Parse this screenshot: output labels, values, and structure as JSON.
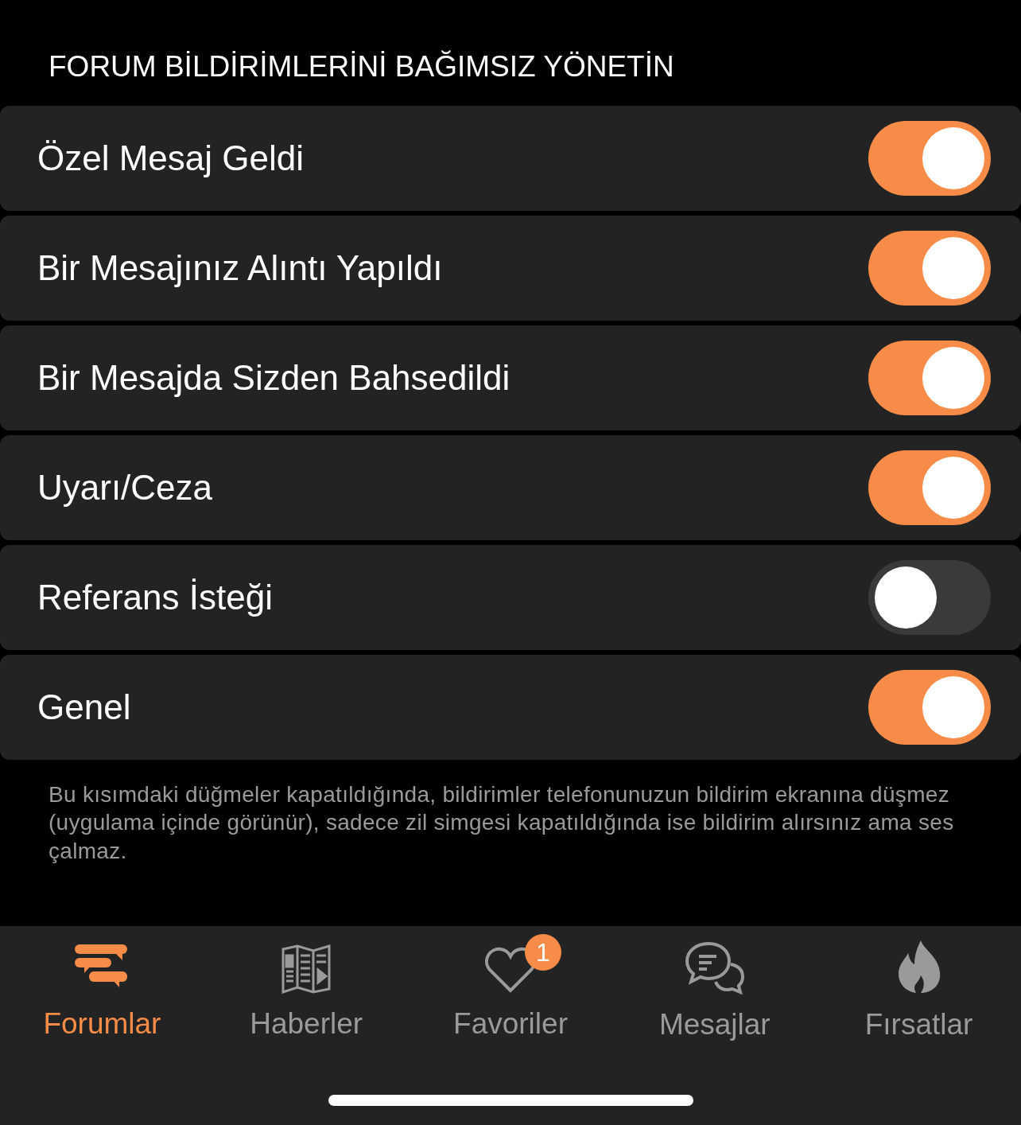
{
  "section_header": "FORUM BİLDİRİMLERİNİ BAĞIMSIZ YÖNETİN",
  "settings": [
    {
      "label": "Özel Mesaj Geldi",
      "on": true
    },
    {
      "label": "Bir Mesajınız Alıntı Yapıldı",
      "on": true
    },
    {
      "label": "Bir Mesajda Sizden Bahsedildi",
      "on": true
    },
    {
      "label": "Uyarı/Ceza",
      "on": true
    },
    {
      "label": "Referans İsteği",
      "on": false
    },
    {
      "label": "Genel",
      "on": true
    }
  ],
  "footer_note": "Bu kısımdaki düğmeler kapatıldığında, bildirimler telefonunuzun bildirim ekranına düşmez (uygulama içinde görünür), sadece zil simgesi kapatıldığında ise bildirim alırsınız ama ses çalmaz.",
  "tab_bar": [
    {
      "kind": "forums",
      "label": "Forumlar",
      "selected": true
    },
    {
      "kind": "news",
      "label": "Haberler",
      "selected": false
    },
    {
      "kind": "favorites",
      "label": "Favoriler",
      "selected": false,
      "badge": "1"
    },
    {
      "kind": "messages",
      "label": "Mesajlar",
      "selected": false
    },
    {
      "kind": "deals",
      "label": "Fırsatlar",
      "selected": false
    }
  ]
}
